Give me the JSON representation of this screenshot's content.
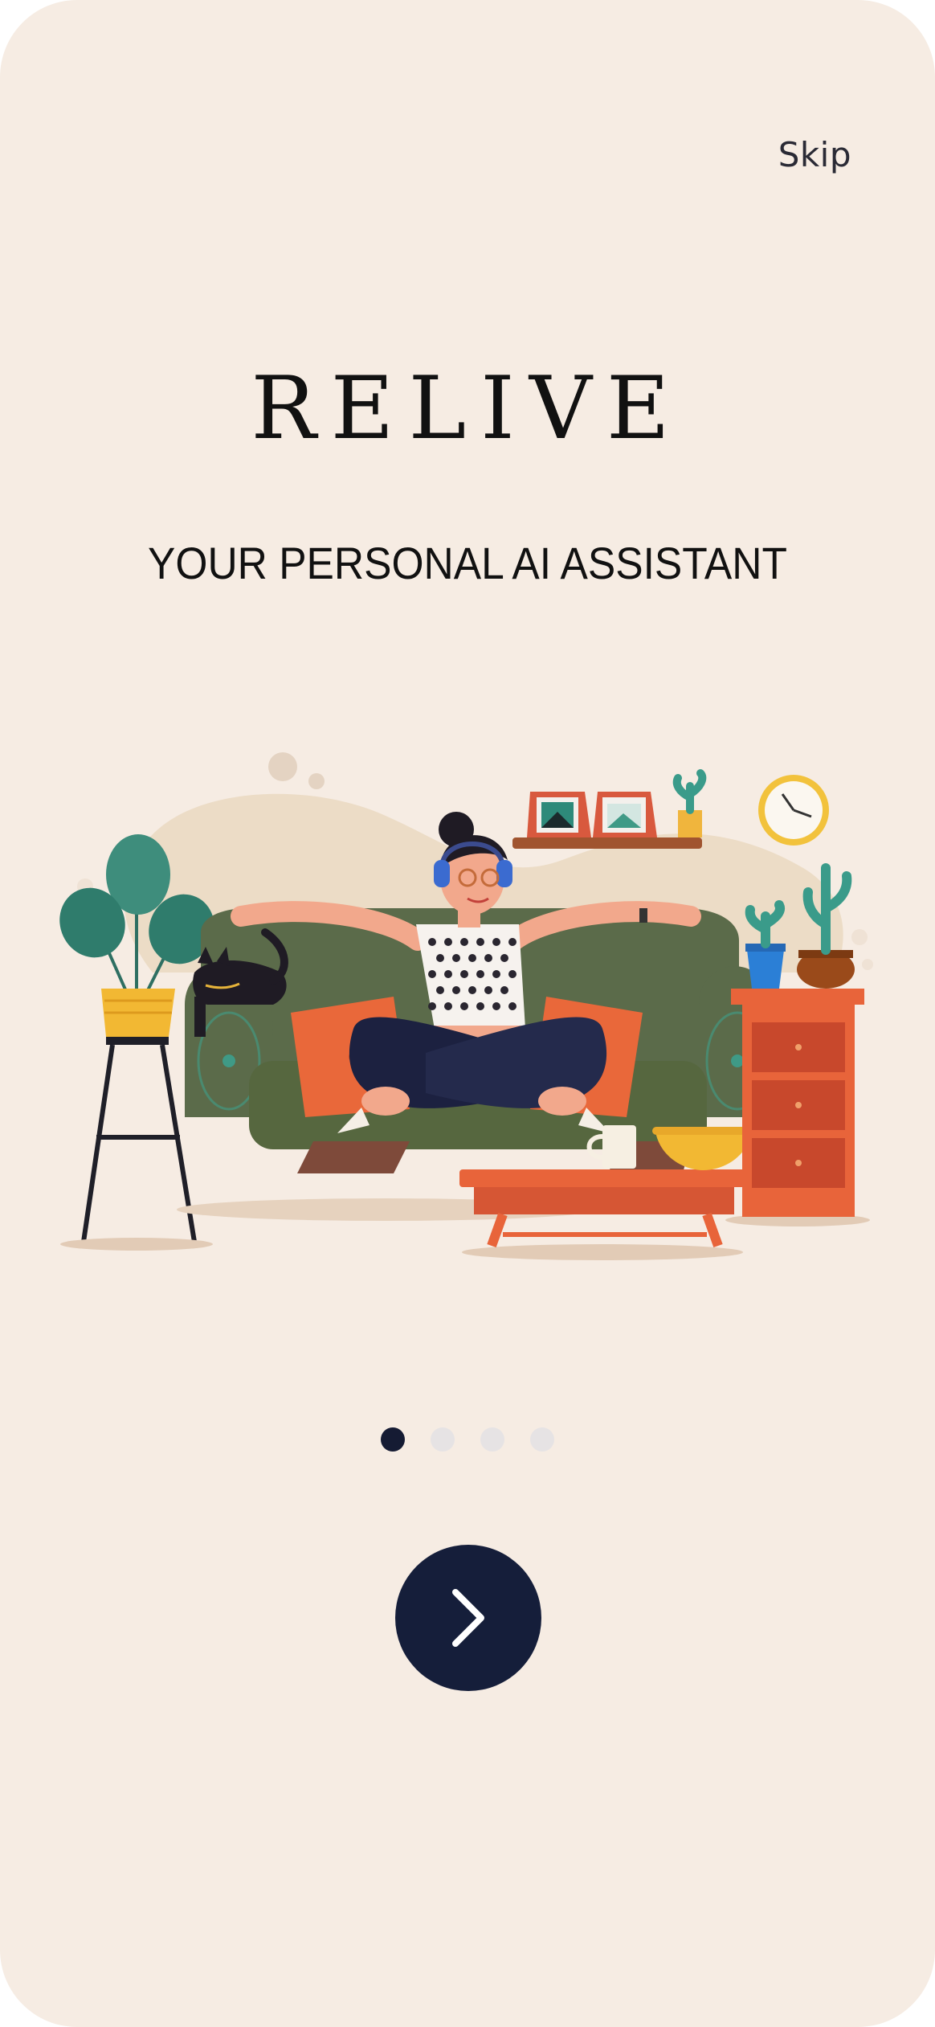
{
  "header": {
    "skip_label": "Skip"
  },
  "hero": {
    "brand_title": "RELIVE",
    "tagline": "YOUR PERSONAL AI ASSISTANT"
  },
  "pagination": {
    "total_pages": 4,
    "current_page": 1
  },
  "actions": {
    "next_icon": "chevron-right-icon"
  },
  "colors": {
    "background": "#f6ece3",
    "primary_dark": "#151e3a",
    "dot_inactive": "#e6e3e4"
  }
}
